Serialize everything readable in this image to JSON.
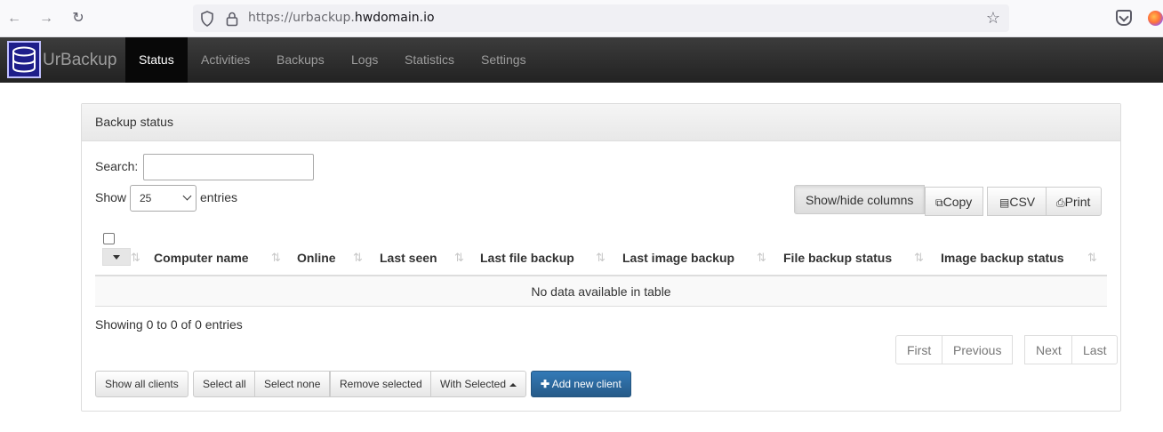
{
  "browser": {
    "url_prefix": "https://urbackup.",
    "url_domain": "hwdomain.io"
  },
  "app": {
    "brand": "UrBackup",
    "nav": [
      {
        "label": "Status",
        "active": true
      },
      {
        "label": "Activities"
      },
      {
        "label": "Backups"
      },
      {
        "label": "Logs"
      },
      {
        "label": "Statistics"
      },
      {
        "label": "Settings"
      }
    ]
  },
  "panel": {
    "title": "Backup status",
    "search_label": "Search:",
    "show_label": "Show",
    "entries_label": "entries",
    "page_size": "25",
    "buttons": {
      "show_hide": "Show/hide columns",
      "copy": "Copy",
      "csv": "CSV",
      "print": "Print"
    },
    "table": {
      "columns": [
        "Computer name",
        "Online",
        "Last seen",
        "Last file backup",
        "Last image backup",
        "File backup status",
        "Image backup status"
      ],
      "empty_message": "No data available in table"
    },
    "info": "Showing 0 to 0 of 0 entries",
    "pagination": [
      "First",
      "Previous",
      "Next",
      "Last"
    ],
    "actions": {
      "show_all_clients": "Show all clients",
      "select_all": "Select all",
      "select_none": "Select none",
      "remove_selected": "Remove selected",
      "with_selected": "With Selected",
      "add_new_client": "Add new client"
    }
  }
}
